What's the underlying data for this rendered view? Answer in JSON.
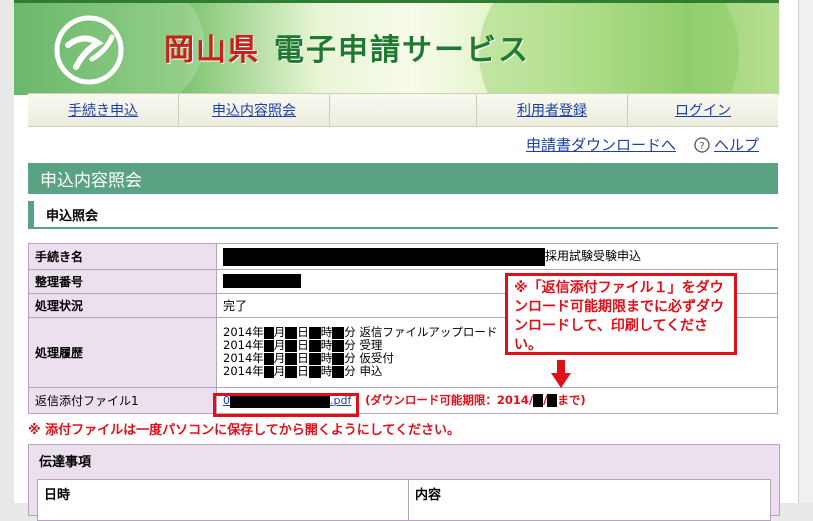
{
  "header": {
    "pref": "岡山県",
    "service": "電子申請サービス"
  },
  "nav": {
    "items": [
      "手続き申込",
      "申込内容照会",
      "利用者登録",
      "ログイン"
    ]
  },
  "sublinks": {
    "download": "申請書ダウンロードへ",
    "help": "ヘルプ"
  },
  "section": {
    "title": "申込内容照会",
    "subtitle": "申込照会"
  },
  "table": {
    "procedure_label": "手続き名",
    "procedure_suffix": "採用試験受験申込",
    "number_label": "整理番号",
    "status_label": "処理状況",
    "status_value": "完了",
    "history_label": "処理履歴",
    "history": [
      {
        "year": "2014年",
        "m": "月",
        "d": "日",
        "h": "時",
        "mi": "分",
        "action": "返信ファイルアップロード"
      },
      {
        "year": "2014年",
        "m": "月",
        "d": "日",
        "h": "時",
        "mi": "分",
        "action": "受理"
      },
      {
        "year": "2014年",
        "m": "月",
        "d": "日",
        "h": "時",
        "mi": "分",
        "action": "仮受付"
      },
      {
        "year": "2014年",
        "m": "月",
        "d": "日",
        "h": "時",
        "mi": "分",
        "action": "申込"
      }
    ],
    "file_label": "返信添付ファイル1",
    "file_prefix": "0",
    "file_ext": ".pdf",
    "deadline_prefix": "(ダウンロード可能期限：2014/",
    "deadline_sep": "/",
    "deadline_suffix": "まで)"
  },
  "annotation": "※「返信添付ファイル１」をダウンロード可能期限までに必ずダウンロードして、印刷してください。",
  "notice": "※ 添付ファイルは一度パソコンに保存してから開くようにしてください。",
  "bottom": {
    "title": "伝達事項",
    "col_date": "日時",
    "col_content": "内容"
  },
  "colors": {
    "accent_green": "#5aa382",
    "alert_red": "#e0101a",
    "link_blue": "#1c3fa8",
    "row_label_bg": "#ecdfee"
  }
}
